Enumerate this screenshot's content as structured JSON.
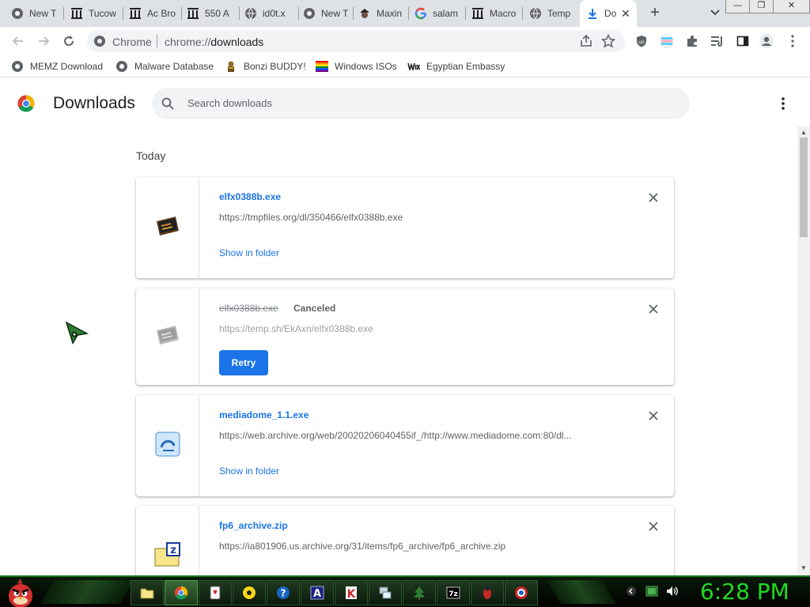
{
  "tabs": [
    {
      "label": "New T",
      "icon": "chrome-globe-icon"
    },
    {
      "label": "Tucow",
      "icon": "archive-building-icon"
    },
    {
      "label": "Ac Bro",
      "icon": "archive-building-icon"
    },
    {
      "label": "550 A",
      "icon": "archive-building-icon"
    },
    {
      "label": "id0t.x",
      "icon": "globe-icon"
    },
    {
      "label": "New T",
      "icon": "chrome-globe-icon"
    },
    {
      "label": "Maxin",
      "icon": "pirate-icon"
    },
    {
      "label": "salam",
      "icon": "google-icon"
    },
    {
      "label": "Macro",
      "icon": "archive-building-icon"
    },
    {
      "label": "Temp",
      "icon": "globe-icon"
    },
    {
      "label": "Do",
      "icon": "download-icon",
      "active": true
    }
  ],
  "window_controls": {
    "minimize": "—",
    "maximize": "❐",
    "close": "✕"
  },
  "toolbar": {
    "omnibox_scheme_label": "Chrome",
    "omnibox_url_host": "chrome://",
    "omnibox_url_path": "downloads"
  },
  "bookmarks": [
    {
      "label": "MEMZ Download",
      "icon": "globe-icon"
    },
    {
      "label": "Malware Database",
      "icon": "globe-icon"
    },
    {
      "label": "Bonzi BUDDY!",
      "icon": "bonzi-icon"
    },
    {
      "label": "Windows ISOs",
      "icon": "windows-flag-icon"
    },
    {
      "label": "Egyptian Embassy",
      "icon": "wix-icon"
    }
  ],
  "downloads_page": {
    "title": "Downloads",
    "search_placeholder": "Search downloads",
    "section_label": "Today",
    "items": [
      {
        "filename": "elfx0388b.exe",
        "url": "https://tmpfiles.org/dl/350466/elfx0388b.exe",
        "action": "Show in folder",
        "state": "complete"
      },
      {
        "filename": "elfx0388b.exe",
        "url": "https://temp.sh/EkAxn/elfx0388b.exe",
        "status": "Canceled",
        "action": "Retry",
        "state": "canceled"
      },
      {
        "filename": "mediadome_1.1.exe",
        "url": "https://web.archive.org/web/20020206040455if_/http://www.mediadome.com:80/dl...",
        "action": "Show in folder",
        "state": "complete"
      },
      {
        "filename": "fp6_archive.zip",
        "url": "https://ia801906.us.archive.org/31/items/fp6_archive/fp6_archive.zip",
        "state": "complete"
      }
    ]
  },
  "taskbar": {
    "clock": "6:28 PM",
    "apps": [
      "folder-icon",
      "chrome-icon",
      "cards-icon",
      "disc-icon",
      "help-icon",
      "a-icon",
      "k-icon",
      "network-icon",
      "tree-icon",
      "7z-icon",
      "bug-icon",
      "badge-icon"
    ],
    "accent_color": "#22d822"
  },
  "colors": {
    "accent_blue": "#1a73e8",
    "tabstrip_bg": "#dee1e6"
  }
}
